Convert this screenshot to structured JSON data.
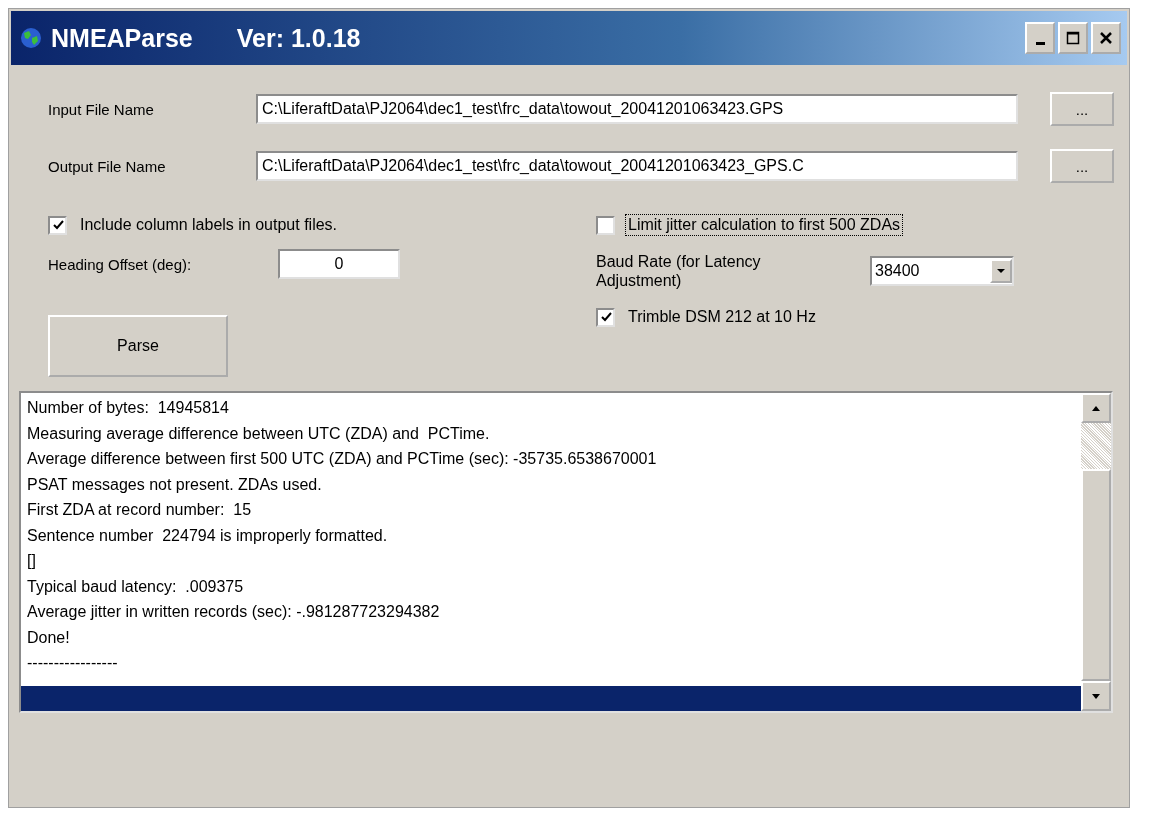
{
  "window": {
    "title": "NMEAParse",
    "version": "Ver: 1.0.18"
  },
  "files": [
    {
      "label": "Input File Name",
      "value": "C:\\LiferaftData\\PJ2064\\dec1_test\\frc_data\\towout_20041201063423.GPS",
      "button": "..."
    },
    {
      "label": "Output File Name",
      "value": "C:\\LiferaftData\\PJ2064\\dec1_test\\frc_data\\towout_20041201063423_GPS.C",
      "button": "..."
    }
  ],
  "include_labels": {
    "label": "Include column labels in output files.",
    "checked": true,
    "focused": false
  },
  "limit_jitter": {
    "label": "Limit jitter calculation to first 500 ZDAs",
    "checked": false,
    "focused": true
  },
  "heading_offset": {
    "label": "Heading Offset (deg):",
    "value": "0"
  },
  "baud_rate": {
    "label": "Baud Rate (for Latency Adjustment)",
    "value": "38400"
  },
  "trimble": {
    "label": "Trimble DSM 212 at 10 Hz",
    "checked": true,
    "focused": false
  },
  "parse_button": "Parse",
  "log": [
    {
      "text": "Number of bytes:  14945814",
      "selected": false
    },
    {
      "text": "Measuring average difference between UTC (ZDA) and  PCTime.",
      "selected": false
    },
    {
      "text": "Average difference between first 500 UTC (ZDA) and PCTime (sec): -35735.6538670001",
      "selected": false
    },
    {
      "text": "PSAT messages not present. ZDAs used.",
      "selected": false
    },
    {
      "text": "First ZDA at record number:  15",
      "selected": false
    },
    {
      "text": "Sentence number  224794 is improperly formatted.",
      "selected": false
    },
    {
      "text": "[]",
      "selected": false
    },
    {
      "text": "Typical baud latency:  .009375",
      "selected": false
    },
    {
      "text": "Average jitter in written records (sec): -.981287723294382",
      "selected": false
    },
    {
      "text": "Done!",
      "selected": false
    },
    {
      "text": "-----------------",
      "selected": false
    },
    {
      "selected": true
    }
  ]
}
